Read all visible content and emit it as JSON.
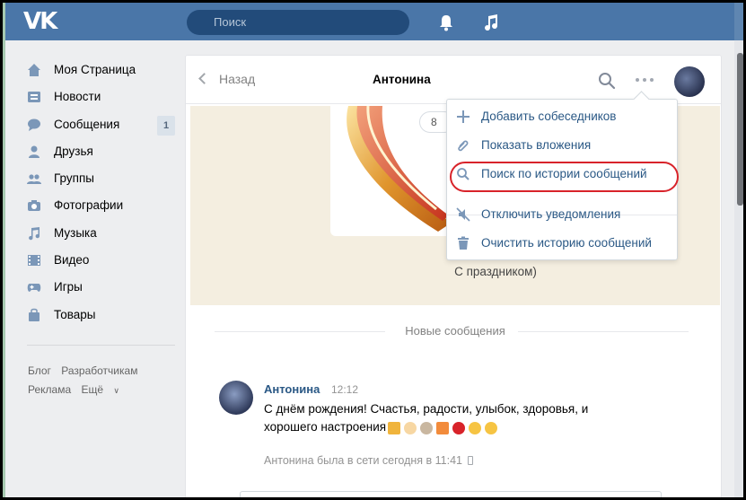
{
  "topbar": {
    "logo": "VK",
    "search_placeholder": "Поиск",
    "icons": [
      "bell-icon",
      "music-icon"
    ],
    "color": "#4a76a8"
  },
  "sidebar": {
    "items": [
      {
        "label": "Моя Страница",
        "icon": "home-icon"
      },
      {
        "label": "Новости",
        "icon": "news-icon"
      },
      {
        "label": "Сообщения",
        "icon": "messages-icon",
        "count": "1"
      },
      {
        "label": "Друзья",
        "icon": "friend-icon"
      },
      {
        "label": "Группы",
        "icon": "groups-icon"
      },
      {
        "label": "Фотографии",
        "icon": "camera-icon"
      },
      {
        "label": "Музыка",
        "icon": "music-icon"
      },
      {
        "label": "Видео",
        "icon": "video-icon"
      },
      {
        "label": "Игры",
        "icon": "gamepad-icon"
      },
      {
        "label": "Товары",
        "icon": "bag-icon"
      }
    ],
    "footer_links": [
      "Блог",
      "Разработчикам",
      "Реклама",
      "Ещё"
    ]
  },
  "chat": {
    "back_label": "Назад",
    "title": "Антонина",
    "gift_bubble": "8",
    "gift_caption": "С праздником)",
    "new_messages_label": "Новые сообщения",
    "message": {
      "author": "Антонина",
      "time": "12:12",
      "text": "С днём рождения! Счастья, радости, улыбок, здоровья, и хорошего настроения",
      "emoji": [
        "gift-icon",
        "ice-cream-icon",
        "coffee-icon",
        "pizza-icon",
        "cherries-icon",
        "grin-icon",
        "wink-kiss-icon"
      ]
    },
    "status": "Антонина была в сети сегодня в 11:41"
  },
  "menu": {
    "items": [
      {
        "label": "Добавить собеседников",
        "icon": "plus-icon"
      },
      {
        "label": "Показать вложения",
        "icon": "paperclip-icon"
      },
      {
        "label": "Поиск по истории сообщений",
        "icon": "search-icon",
        "highlighted": true
      },
      {
        "label": "Отключить уведомления",
        "icon": "mute-icon"
      },
      {
        "label": "Очистить историю сообщений",
        "icon": "trash-icon"
      }
    ],
    "highlight_color": "#d8232a",
    "link_color": "#2a5885"
  }
}
